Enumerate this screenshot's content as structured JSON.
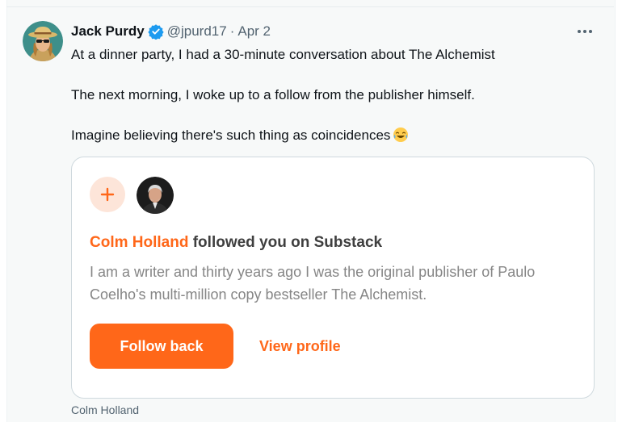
{
  "tweet": {
    "author_name": "Jack Purdy",
    "handle": "@jpurd17",
    "separator": "·",
    "date": "Apr 2",
    "lines": [
      "At a dinner party, I had a 30-minute conversation about The Alchemist",
      "The next morning, I woke up to a follow from the publisher himself.",
      "Imagine believing there's such thing as coincidences"
    ],
    "emoji": "face-with-tears-of-joy",
    "verified_color": "#1d9bf0"
  },
  "card": {
    "follower_name": "Colm Holland",
    "title_rest": "followed you on Substack",
    "description_lines": [
      "I am a writer and thirty years ago I was the original publisher of Paulo",
      "Coelho's multi-million copy bestseller The Alchemist."
    ],
    "follow_back_label": "Follow back",
    "view_profile_label": "View profile",
    "accent_color": "#ff6719"
  },
  "caption": "Colm Holland"
}
